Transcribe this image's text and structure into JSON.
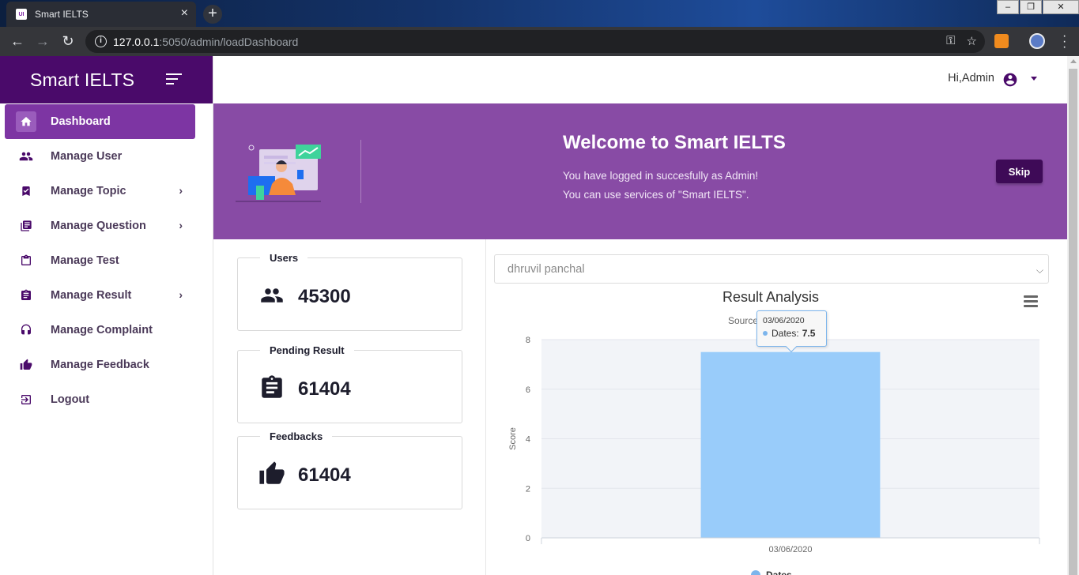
{
  "browser": {
    "tab_title": "Smart IELTS",
    "favicon_text": "UI",
    "new_tab": "+",
    "url_host": "127.0.0.1",
    "url_path": ":5050/admin/loadDashboard"
  },
  "sidebar": {
    "brand": "Smart IELTS",
    "items": [
      {
        "label": "Dashboard",
        "icon": "home-icon",
        "active": true
      },
      {
        "label": "Manage User",
        "icon": "users-icon"
      },
      {
        "label": "Manage Topic",
        "icon": "bookmark-check-icon",
        "has_submenu": true
      },
      {
        "label": "Manage Question",
        "icon": "library-books-icon",
        "has_submenu": true
      },
      {
        "label": "Manage Test",
        "icon": "clipboard-icon"
      },
      {
        "label": "Manage Result",
        "icon": "assignment-icon",
        "has_submenu": true
      },
      {
        "label": "Manage Complaint",
        "icon": "headset-icon"
      },
      {
        "label": "Manage Feedback",
        "icon": "thumbs-up-icon"
      },
      {
        "label": "Logout",
        "icon": "logout-icon"
      }
    ]
  },
  "header": {
    "greeting": "Hi,Admin",
    "user_icon": "account-circle-icon"
  },
  "banner": {
    "title": "Welcome to Smart IELTS",
    "line1": "You have logged in succesfully as Admin!",
    "line2": "You can use services of \"Smart IELTS\".",
    "skip_label": "Skip"
  },
  "stats": [
    {
      "label": "Users",
      "value": "45300",
      "icon": "users-icon"
    },
    {
      "label": "Pending Result",
      "value": "61404",
      "icon": "assignment-icon"
    },
    {
      "label": "Feedbacks",
      "value": "61404",
      "icon": "thumbs-up-icon"
    }
  ],
  "student_select": {
    "selected": "dhruvil panchal"
  },
  "chart_data": {
    "type": "bar",
    "title": "Result Analysis",
    "subtitle": "Source",
    "xlabel": "",
    "ylabel": "Score",
    "categories": [
      "03/06/2020"
    ],
    "series": [
      {
        "name": "Dates",
        "values": [
          7.5
        ],
        "color": "#99ccfa"
      }
    ],
    "ylim": [
      0,
      8
    ],
    "yticks": [
      0,
      2,
      4,
      6,
      8
    ],
    "grid": true,
    "legend": "bottom",
    "tooltip": {
      "date": "03/06/2020",
      "series": "Dates:",
      "value": "7.5"
    }
  },
  "colors": {
    "brand_dark": "#4a0a6a",
    "banner": "#884ba5",
    "active_menu": "#7d35a3",
    "bar": "#99ccfa"
  }
}
